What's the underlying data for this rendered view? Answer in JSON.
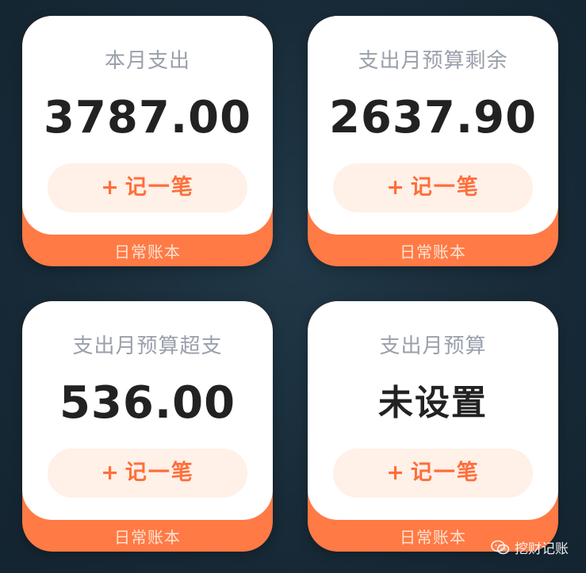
{
  "widgets": [
    {
      "title": "本月支出",
      "value": "3787.00",
      "button_label": "记一笔",
      "book": "日常账本"
    },
    {
      "title": "支出月预算剩余",
      "value": "2637.90",
      "button_label": "记一笔",
      "book": "日常账本"
    },
    {
      "title": "支出月预算超支",
      "value": "536.00",
      "button_label": "记一笔",
      "book": "日常账本"
    },
    {
      "title": "支出月预算",
      "value": "未设置",
      "button_label": "记一笔",
      "book": "日常账本"
    }
  ],
  "icons": {
    "plus": "plus-icon",
    "watermark": "wechat-icon"
  },
  "colors": {
    "accent": "#ff7a45",
    "button_bg": "#fff0e8",
    "button_text": "#ff6e3a",
    "title_text": "#9aa0ab",
    "value_text": "#222222"
  },
  "watermark": {
    "text": "挖财记账"
  }
}
